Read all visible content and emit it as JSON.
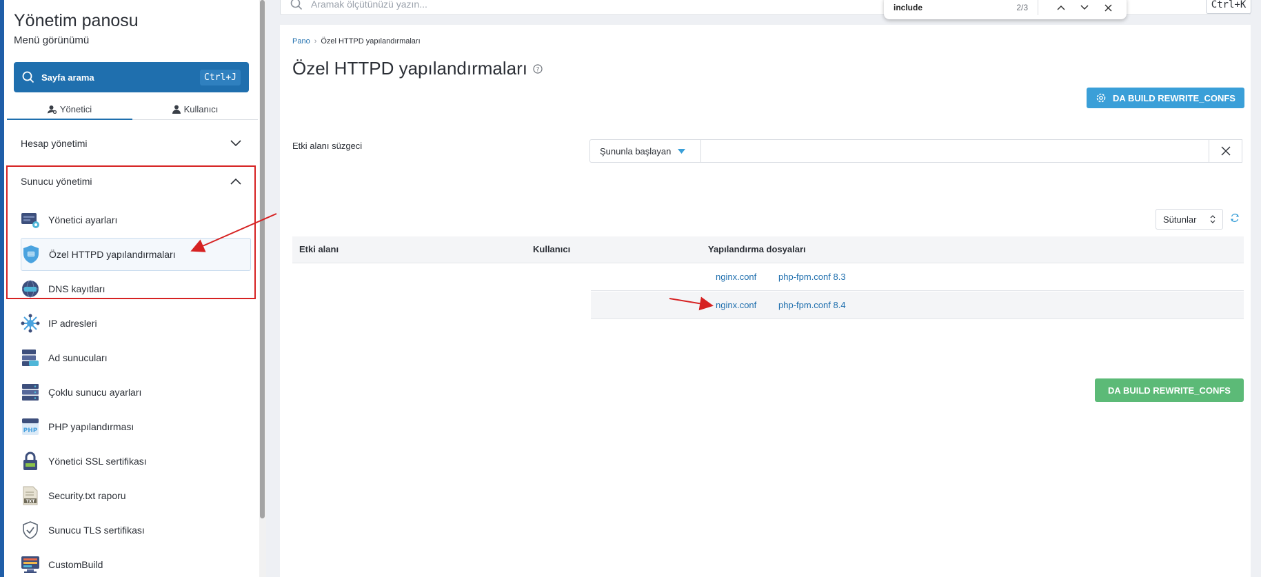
{
  "sidebar": {
    "title": "Yönetim panosu",
    "subtitle": "Menü görünümü",
    "search_label": "Sayfa arama",
    "search_shortcut": "Ctrl+J",
    "role_tabs": [
      "Yönetici",
      "Kullanıcı"
    ],
    "sections": {
      "account": "Hesap yönetimi",
      "server": "Sunucu yönetimi"
    },
    "items": [
      "Yönetici ayarları",
      "Özel HTTPD yapılandırmaları",
      "DNS kayıtları",
      "IP adresleri",
      "Ad sunucuları",
      "Çoklu sunucu ayarları",
      "PHP yapılandırması",
      "Yönetici SSL sertifikası",
      "Security.txt raporu",
      "Sunucu TLS sertifikası",
      "CustomBuild"
    ],
    "php_badge": "PHP",
    "txt_badge": "TXT"
  },
  "topbar": {
    "search_placeholder": "Aramak ölçütünüzü yazın...",
    "shortcut": "Ctrl+K"
  },
  "findbar": {
    "term": "include",
    "count": "2/3"
  },
  "main": {
    "breadcrumb_home": "Pano",
    "breadcrumb_current": "Özel HTTPD yapılandırmaları",
    "title": "Özel HTTPD yapılandırmaları",
    "rewrite_button": "DA BUILD REWRITE_CONFS",
    "filter_label": "Etki alanı süzgeci",
    "filter_mode": "Şununla başlayan",
    "filter_value": "",
    "columns_label": "Sütunlar",
    "table": {
      "headers": [
        "Etki alanı",
        "Kullanıcı",
        "Yapılandırma dosyaları"
      ],
      "rows": [
        {
          "nginx": "nginx.conf",
          "phpfpm": "php-fpm.conf 8.3"
        },
        {
          "nginx": "nginx.conf",
          "phpfpm": "php-fpm.conf 8.4"
        }
      ]
    },
    "rewrite_button_bottom": "DA BUILD REWRITE_CONFS"
  },
  "colors": {
    "primary": "#1f6fae",
    "info_button": "#3a9fd8",
    "success_button": "#5cba77",
    "annotation_red": "#d62222"
  }
}
